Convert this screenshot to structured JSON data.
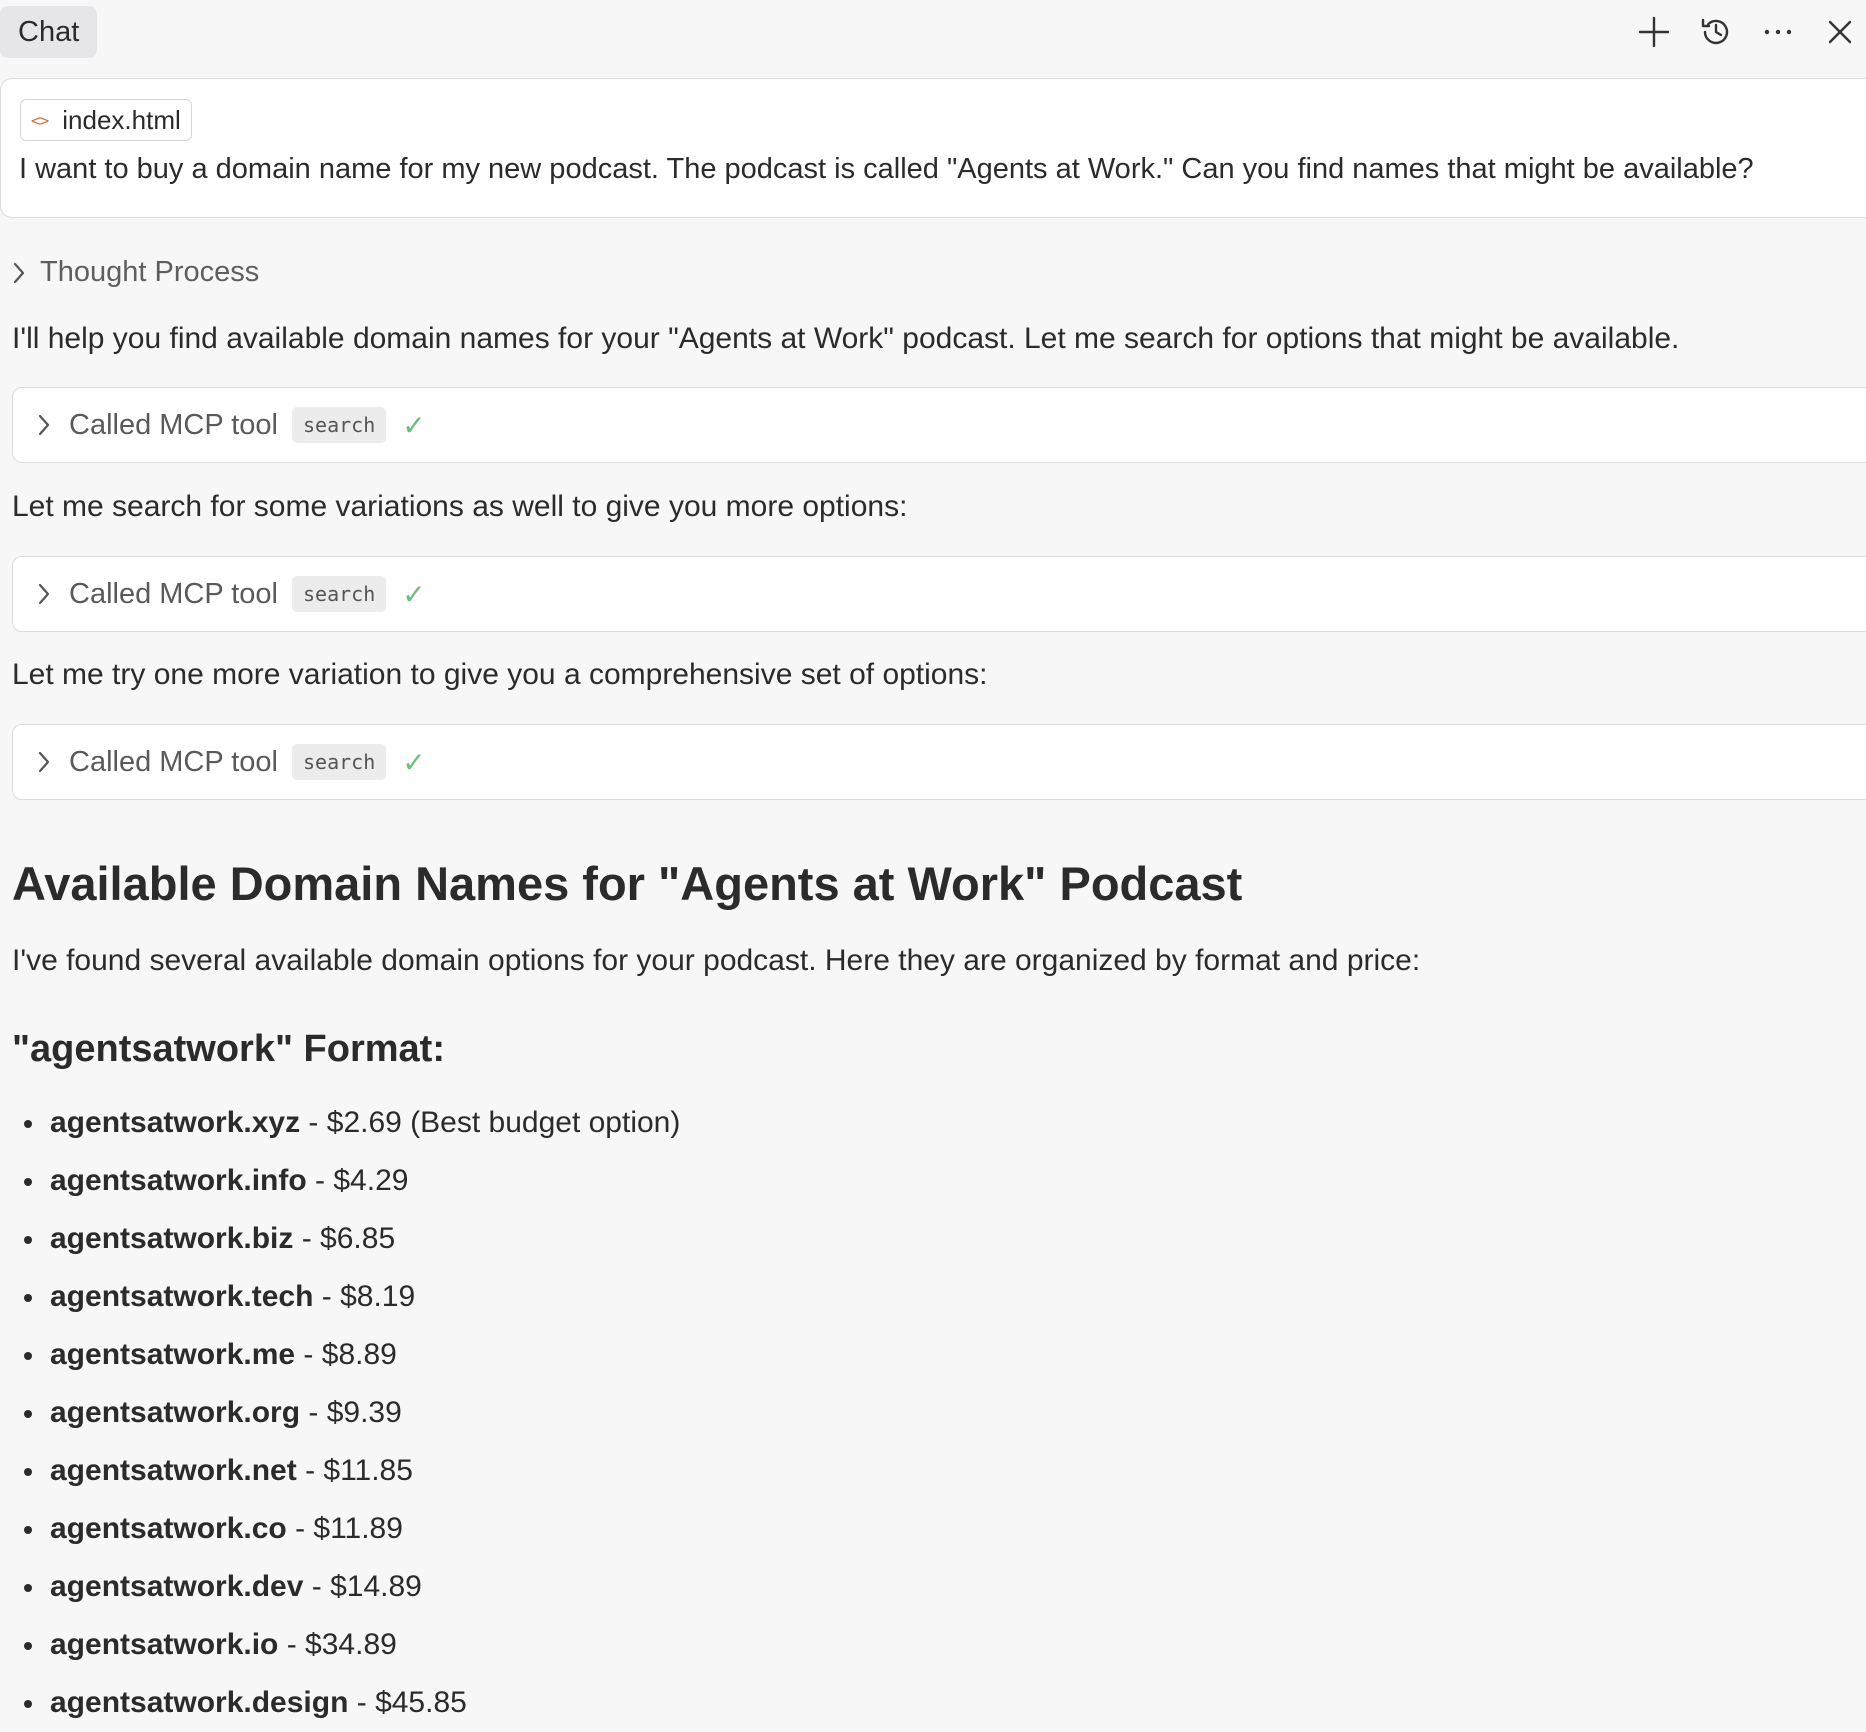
{
  "header": {
    "tab_label": "Chat",
    "icons": [
      "plus-icon",
      "history-icon",
      "more-icon",
      "close-icon"
    ]
  },
  "user_message": {
    "attachment": "index.html",
    "text": "I want to buy a domain name for my new podcast. The podcast is called \"Agents at Work.\" Can you find names that might be available?"
  },
  "assistant": {
    "thought_label": "Thought Process",
    "intro": "I'll help you find available domain names for your \"Agents at Work\" podcast. Let me search for options that might be available.",
    "tool_calls": [
      {
        "label": "Called MCP tool",
        "tool": "search",
        "status": "✓"
      },
      {
        "label": "Called MCP tool",
        "tool": "search",
        "status": "✓"
      },
      {
        "label": "Called MCP tool",
        "tool": "search",
        "status": "✓"
      }
    ],
    "between_1": "Let me search for some variations as well to give you more options:",
    "between_2": "Let me try one more variation to give you a comprehensive set of options:",
    "heading": "Available Domain Names for \"Agents at Work\" Podcast",
    "summary": "I've found several available domain options for your podcast. Here they are organized by format and price:",
    "section_heading": "\"agentsatwork\" Format:",
    "domains": [
      {
        "name": "agentsatwork.xyz",
        "price": " - $2.69 (Best budget option)"
      },
      {
        "name": "agentsatwork.info",
        "price": " - $4.29"
      },
      {
        "name": "agentsatwork.biz",
        "price": " - $6.85"
      },
      {
        "name": "agentsatwork.tech",
        "price": " - $8.19"
      },
      {
        "name": "agentsatwork.me",
        "price": " - $8.89"
      },
      {
        "name": "agentsatwork.org",
        "price": " - $9.39"
      },
      {
        "name": "agentsatwork.net",
        "price": " - $11.85"
      },
      {
        "name": "agentsatwork.co",
        "price": " - $11.89"
      },
      {
        "name": "agentsatwork.dev",
        "price": " - $14.89"
      },
      {
        "name": "agentsatwork.io",
        "price": " - $34.89"
      },
      {
        "name": "agentsatwork.design",
        "price": " - $45.85"
      }
    ]
  },
  "colors": {
    "background": "#f7f7f7",
    "card": "#ffffff",
    "check": "#6bbf7a",
    "file_icon": "#c9733d"
  }
}
